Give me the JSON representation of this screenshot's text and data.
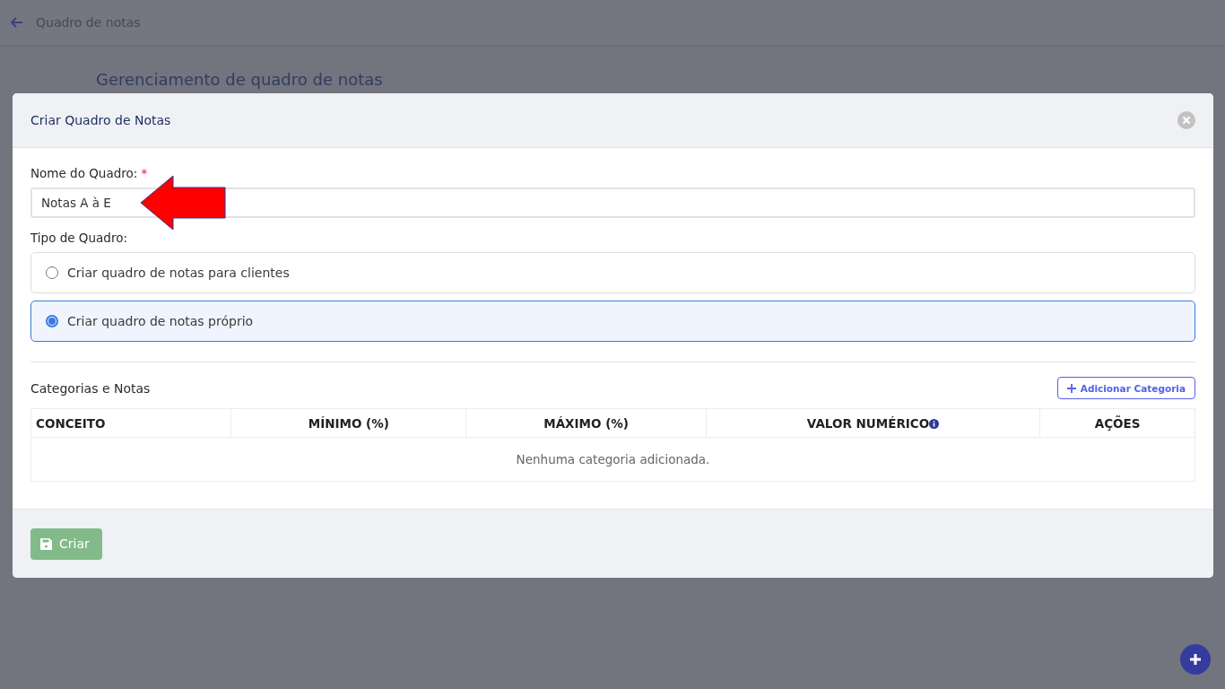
{
  "topbar": {
    "title": "Quadro de notas"
  },
  "page": {
    "heading": "Gerenciamento de quadro de notas"
  },
  "modal": {
    "title": "Criar Quadro de Notas",
    "name_field": {
      "label": "Nome do Quadro:",
      "required_mark": "*",
      "value": "Notas A à E"
    },
    "type_label": "Tipo de Quadro:",
    "options": [
      {
        "label": "Criar quadro de notas para clientes",
        "selected": false
      },
      {
        "label": "Criar quadro de notas próprio",
        "selected": true
      }
    ],
    "section_title": "Categorias e Notas",
    "add_button": "Adicionar Categoria",
    "table": {
      "columns": [
        {
          "label": "CONCEITO",
          "has_info": false
        },
        {
          "label": "MÍNIMO (%)",
          "has_info": false
        },
        {
          "label": "MÁXIMO (%)",
          "has_info": false
        },
        {
          "label": "VALOR NUMÉRICO",
          "has_info": true
        },
        {
          "label": "AÇÕES",
          "has_info": false
        }
      ],
      "empty_message": "Nenhuma categoria adicionada."
    },
    "submit": {
      "label": "Criar",
      "disabled": true
    }
  }
}
